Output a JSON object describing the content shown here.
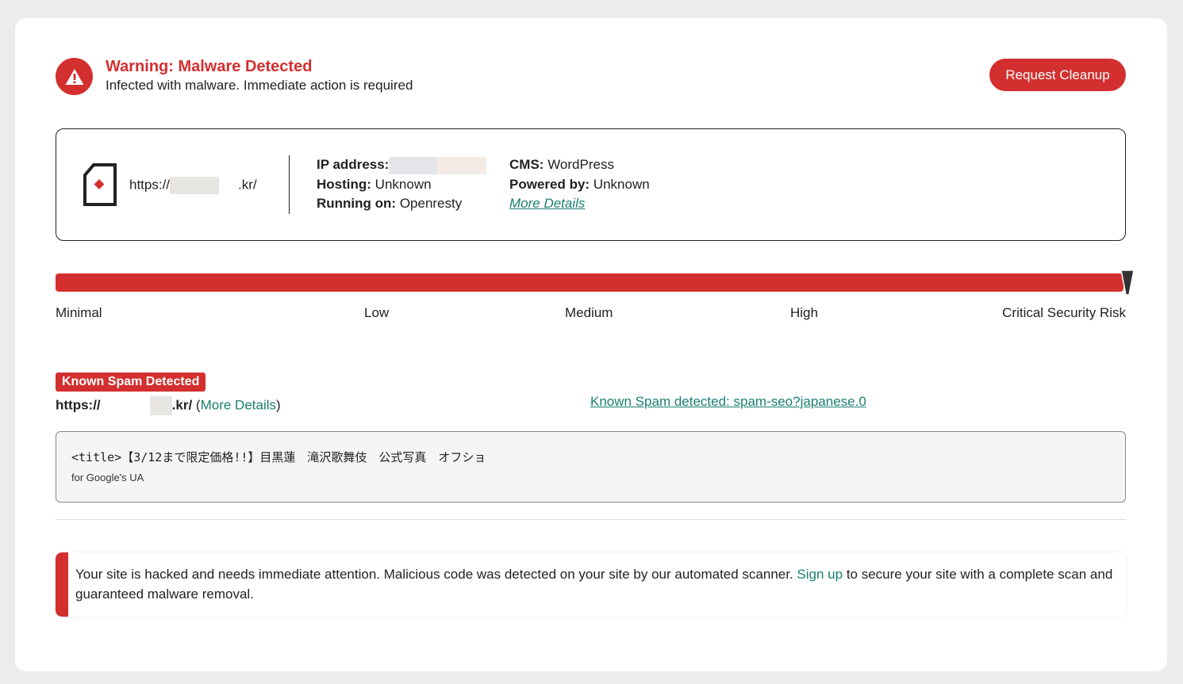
{
  "header": {
    "title": "Warning: Malware Detected",
    "subtitle": "Infected with malware. Immediate action is required",
    "cleanup_button": "Request Cleanup"
  },
  "site": {
    "url_prefix": "https://",
    "url_suffix": ".kr/",
    "ip_label": "IP address:",
    "hosting_label": "Hosting:",
    "hosting_value": "Unknown",
    "running_label": "Running on:",
    "running_value": "Openresty",
    "cms_label": "CMS:",
    "cms_value": "WordPress",
    "powered_label": "Powered by:",
    "powered_value": "Unknown",
    "more_details": "More Details"
  },
  "risk": {
    "levels": [
      "Minimal",
      "Low",
      "Medium",
      "High",
      "Critical Security Risk"
    ],
    "current": "Critical Security Risk",
    "level_fraction": 1.0
  },
  "spam": {
    "badge": "Known Spam Detected",
    "url_prefix": "https://",
    "url_suffix": ".kr/",
    "more_open": "(",
    "more_details": "More Details",
    "more_close": ")",
    "detected_link": "Known Spam detected: spam-seo?japanese.0",
    "code_line": "<title>【3/12まで限定価格!!】目黒蓮　滝沢歌舞伎　公式写真　オフショ",
    "code_note": "for Google's UA"
  },
  "alert": {
    "text_before": "Your site is hacked and needs immediate attention. Malicious code was detected on your site by our automated scanner. ",
    "signup_link": "Sign up",
    "text_after": " to secure your site with a complete scan and guaranteed malware removal."
  },
  "colors": {
    "danger": "#d32f2f",
    "link": "#1a7f72"
  }
}
